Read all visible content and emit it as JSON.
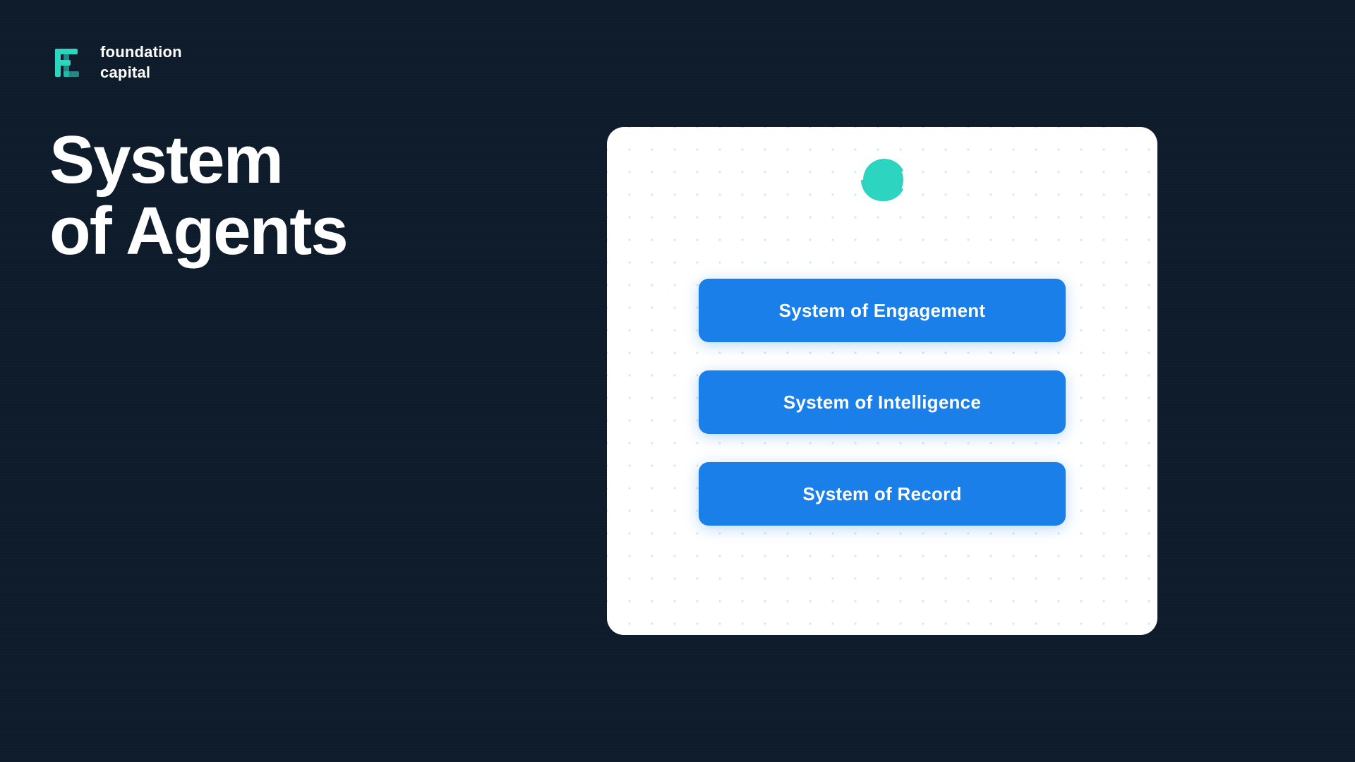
{
  "logo": {
    "text": "foundation\ncapital",
    "icon_color": "#2dd4bf"
  },
  "heading": {
    "line1": "System",
    "line2": "of Agents"
  },
  "card": {
    "buttons": [
      {
        "id": "engagement",
        "label": "System of Engagement"
      },
      {
        "id": "intelligence",
        "label": "System of Intelligence"
      },
      {
        "id": "record",
        "label": "System of Record"
      }
    ]
  },
  "colors": {
    "background": "#0d1b2a",
    "card_bg": "#ffffff",
    "button_bg": "#1a7fe8",
    "button_text": "#ffffff",
    "logo_icon": "#2dd4bf",
    "dot_grid": "#a8ddd9"
  }
}
